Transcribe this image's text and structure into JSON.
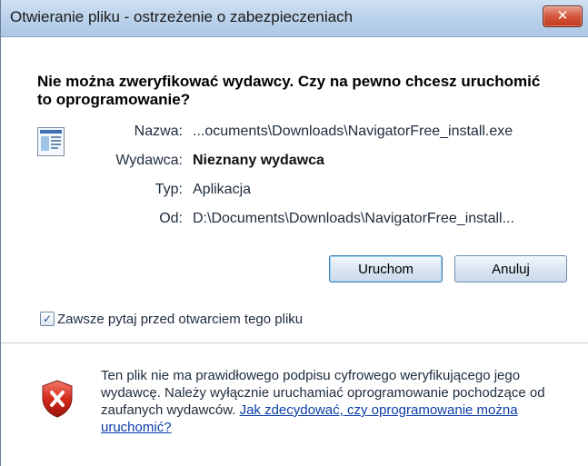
{
  "window": {
    "title": "Otwieranie pliku - ostrzeżenie o zabezpieczeniach",
    "close_label": "✕"
  },
  "heading": "Nie można zweryfikować wydawcy. Czy na pewno chcesz uruchomić to oprogramowanie?",
  "file": {
    "icon": "application-file-icon",
    "fields": [
      {
        "label": "Nazwa:",
        "value": "...ocuments\\Downloads\\NavigatorFree_install.exe"
      },
      {
        "label": "Wydawca:",
        "value": "Nieznany wydawca"
      },
      {
        "label": "Typ:",
        "value": "Aplikacja"
      },
      {
        "label": "Od:",
        "value": "D:\\Documents\\Downloads\\NavigatorFree_install..."
      }
    ]
  },
  "buttons": {
    "run_label": "Uruchom",
    "cancel_label": "Anuluj"
  },
  "checkbox": {
    "label": "Zawsze pytaj przed otwarciem tego pliku",
    "checked": true
  },
  "warning": {
    "icon": "red-shield-x-icon",
    "text": "Ten plik nie ma prawidłowego podpisu cyfrowego weryfikującego jego wydawcę. Należy wyłącznie uruchamiać oprogramowanie pochodzące od zaufanych wydawców. ",
    "link_text": "Jak zdecydować, czy oprogramowanie można uruchomić?"
  },
  "colors": {
    "link": "#0a3ca8",
    "titlebar": "#b9d1ea",
    "close_button": "#c23a1c"
  }
}
